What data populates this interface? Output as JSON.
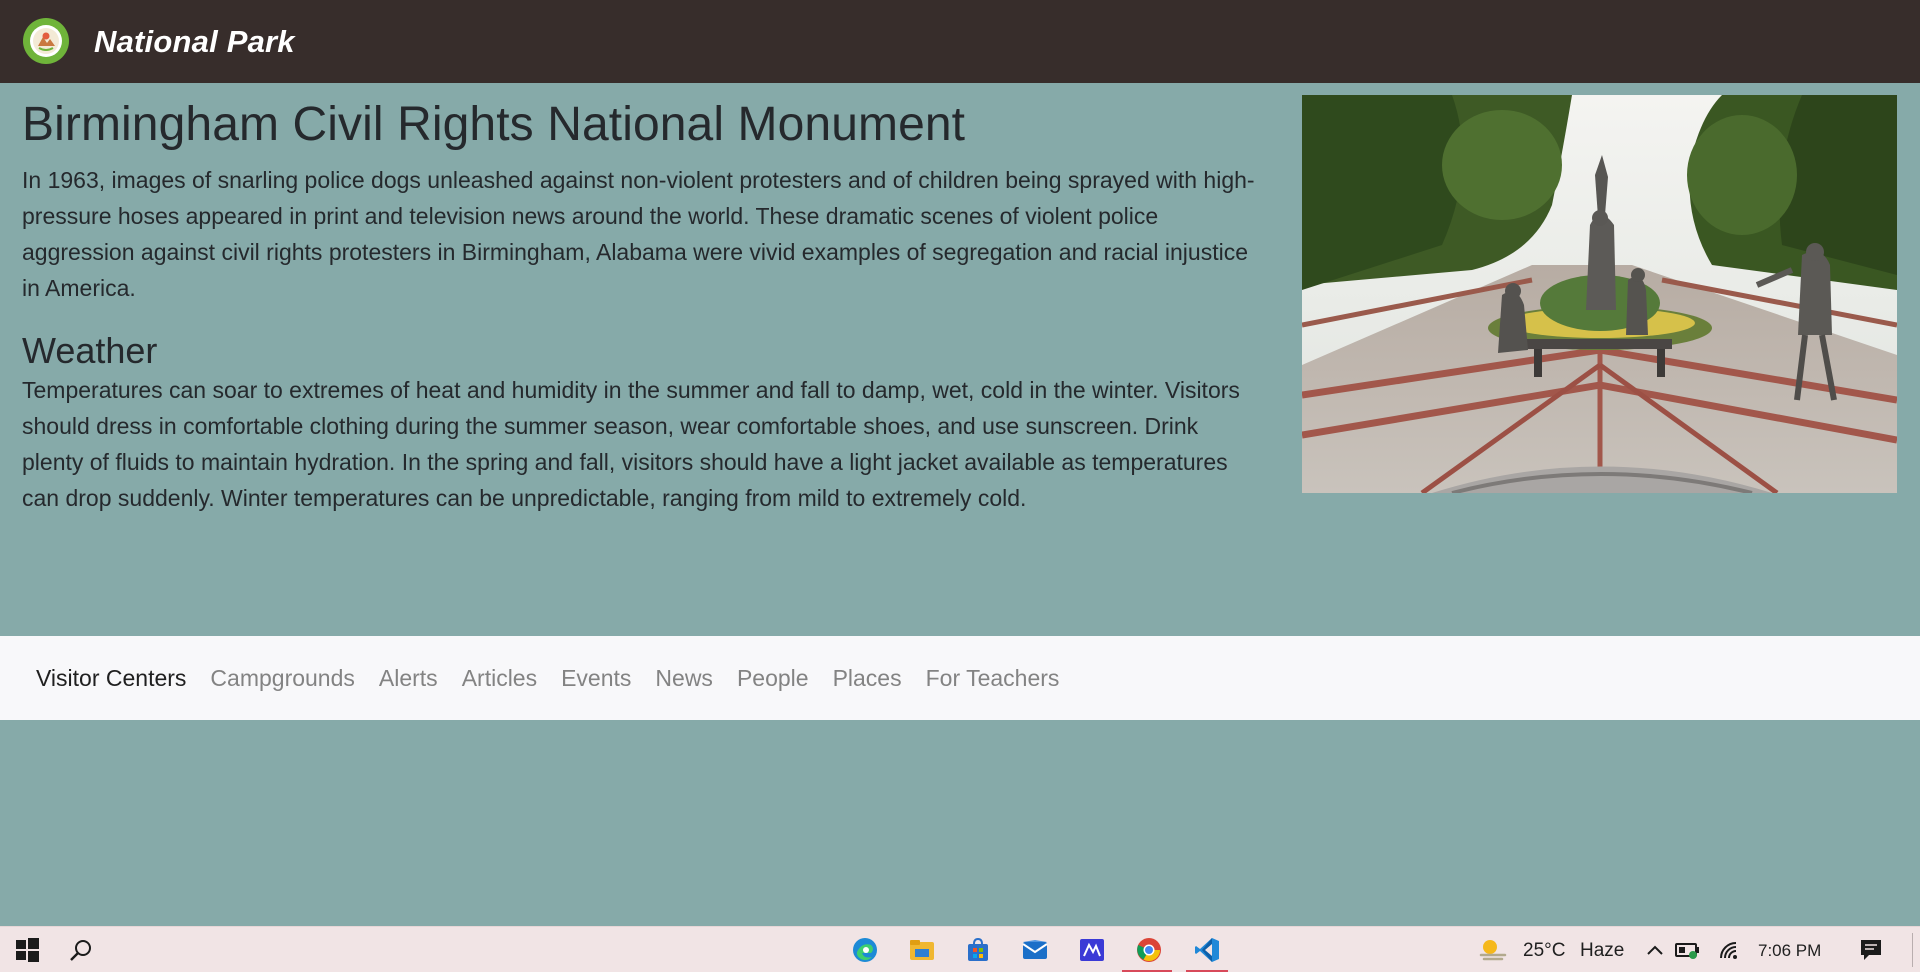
{
  "header": {
    "brand": "National Park"
  },
  "park": {
    "name": "Birmingham Civil Rights National Monument",
    "description": "In 1963, images of snarling police dogs unleashed against non-violent protesters and of children being sprayed with high-pressure hoses appeared in print and television news around the world. These dramatic scenes of violent police aggression against civil rights protesters in Birmingham, Alabama were vivid examples of segregation and racial injustice in America.",
    "weather_heading": "Weather",
    "weather_text": "Temperatures can soar to extremes of heat and humidity in the summer and fall to damp, wet, cold in the winter. Visitors should dress in comfortable clothing during the summer season, wear comfortable shoes, and use sunscreen. Drink plenty of fluids to maintain hydration. In the spring and fall, visitors should have a light jacket available as temperatures can drop suddenly. Winter temperatures can be unpredictable, ranging from mild to extremely cold."
  },
  "subnav": {
    "items": [
      {
        "label": "Visitor Centers",
        "active": true
      },
      {
        "label": "Campgrounds",
        "active": false
      },
      {
        "label": "Alerts",
        "active": false
      },
      {
        "label": "Articles",
        "active": false
      },
      {
        "label": "Events",
        "active": false
      },
      {
        "label": "News",
        "active": false
      },
      {
        "label": "People",
        "active": false
      },
      {
        "label": "Places",
        "active": false
      },
      {
        "label": "For Teachers",
        "active": false
      }
    ]
  },
  "taskbar": {
    "apps": [
      "windows-start-icon",
      "search-icon",
      "edge-icon",
      "file-explorer-icon",
      "store-icon",
      "mail-icon",
      "app-icon",
      "chrome-icon",
      "vscode-icon"
    ],
    "weather": {
      "temperature": "25°C",
      "condition": "Haze"
    },
    "clock": "7:06 PM"
  },
  "colors": {
    "header_bg": "#372d2b",
    "page_bg": "#86aaa9",
    "subnav_bg": "#f8f8fa",
    "taskbar_bg": "#f1e4e5"
  }
}
